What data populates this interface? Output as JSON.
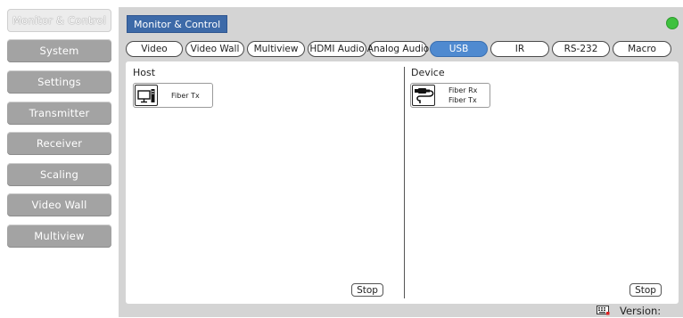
{
  "sidebar": {
    "items": [
      {
        "label": "Monitor & Control",
        "active": true
      },
      {
        "label": "System",
        "active": false
      },
      {
        "label": "Settings",
        "active": false
      },
      {
        "label": "Transmitter",
        "active": false
      },
      {
        "label": "Receiver",
        "active": false
      },
      {
        "label": "Scaling",
        "active": false
      },
      {
        "label": "Video Wall",
        "active": false
      },
      {
        "label": "Multiview",
        "active": false
      }
    ]
  },
  "header": {
    "title": "Monitor & Control",
    "status_color": "#3ec13e"
  },
  "tabs": [
    {
      "label": "Video",
      "active": false
    },
    {
      "label": "Video Wall",
      "active": false
    },
    {
      "label": "Multiview",
      "active": false
    },
    {
      "label": "HDMI Audio",
      "active": false
    },
    {
      "label": "Analog Audio",
      "active": false
    },
    {
      "label": "USB",
      "active": true
    },
    {
      "label": "IR",
      "active": false
    },
    {
      "label": "RS-232",
      "active": false
    },
    {
      "label": "Macro",
      "active": false
    }
  ],
  "host": {
    "title": "Host",
    "card": {
      "icon": "computer-icon",
      "lines": [
        "Fiber Tx"
      ]
    },
    "stop_label": "Stop"
  },
  "device": {
    "title": "Device",
    "card": {
      "icon": "usb-device-icon",
      "lines": [
        "Fiber Rx",
        "Fiber Tx"
      ]
    },
    "stop_label": "Stop"
  },
  "footer": {
    "keyboard_icon": "keyboard-icon",
    "version_label": "Version:"
  },
  "colors": {
    "accent": "#3d6aa8",
    "active_tab": "#4f8ad0",
    "sidebar_button": "#a3a3a3",
    "panel_bg": "#d4d4d4"
  }
}
